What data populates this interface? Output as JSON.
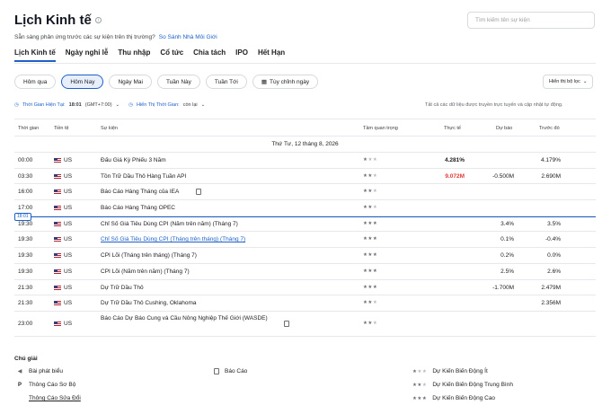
{
  "header": {
    "title": "Lịch Kinh tế",
    "info_icon": "info-icon",
    "search_placeholder": "Tìm kiếm tên sự kiện"
  },
  "subtitle": {
    "text": "Sẵn sàng phản ứng trước các sự kiện trên thị trường?",
    "link": "So Sánh Nhà Môi Giới"
  },
  "tabs": [
    "Lịch Kinh tế",
    "Ngày nghỉ lễ",
    "Thu nhập",
    "Cổ tức",
    "Chia tách",
    "IPO",
    "Hết Hạn"
  ],
  "chips": [
    "Hôm qua",
    "Hôm Nay",
    "Ngày Mai",
    "Tuần Này",
    "Tuần Tới",
    "Tùy chỉnh ngày"
  ],
  "filter_button": "Hiển thị bộ lọc",
  "time_info": {
    "label": "Thời Gian Hiện Tại:",
    "time": "18:01",
    "tz": "(GMT+7:00)",
    "display_label": "Hiển Thị Thời Gian:",
    "display_value": "còn lại"
  },
  "note": "Tất cả các dữ liệu được truyền trực tuyến và cập nhật tự động.",
  "table": {
    "headers": {
      "time": "Thời gian",
      "currency": "Tiền tệ",
      "event": "Sự kiện",
      "importance": "Tầm quan trọng",
      "actual": "Thực tế",
      "forecast": "Dự báo",
      "previous": "Trước đó"
    },
    "date": "Thứ Tư, 12 tháng 8, 2026",
    "now_marker": "18:01",
    "rows": [
      {
        "time": "00:00",
        "cur": "US",
        "event": "Đấu Giá Kỳ Phiếu 3 Năm",
        "imp": 1,
        "actual": "4.281%",
        "forecast": "",
        "previous": "4.179%"
      },
      {
        "time": "03:30",
        "cur": "US",
        "event": "Tồn Trữ Dầu Thô Hàng Tuần API",
        "imp": 2,
        "actual": "9.072M",
        "forecast": "-0.500M",
        "previous": "2.690M"
      },
      {
        "time": "16:00",
        "cur": "US",
        "event": "Báo Cáo Hàng Tháng của IEA",
        "imp": 2,
        "actual": "",
        "forecast": "",
        "previous": ""
      },
      {
        "time": "17:00",
        "cur": "US",
        "event": "Báo Cáo Hàng Tháng OPEC",
        "imp": 2,
        "actual": "",
        "forecast": "",
        "previous": ""
      },
      {
        "time": "19:30",
        "cur": "US",
        "event": "Chỉ Số Giá Tiêu Dùng CPI (Năm trên năm) (Tháng 7)",
        "imp": 3,
        "actual": "",
        "forecast": "3.4%",
        "previous": "3.5%"
      },
      {
        "time": "19:30",
        "cur": "US",
        "event": "Chỉ Số Giá Tiêu Dùng CPI (Tháng trên tháng) (Tháng 7)",
        "imp": 3,
        "actual": "",
        "forecast": "0.1%",
        "previous": "-0.4%"
      },
      {
        "time": "19:30",
        "cur": "US",
        "event": "CPI Lõi (Tháng trên tháng) (Tháng 7)",
        "imp": 3,
        "actual": "",
        "forecast": "0.2%",
        "previous": "0.0%"
      },
      {
        "time": "19:30",
        "cur": "US",
        "event": "CPI Lõi (Năm trên năm) (Tháng 7)",
        "imp": 3,
        "actual": "",
        "forecast": "2.5%",
        "previous": "2.6%"
      },
      {
        "time": "21:30",
        "cur": "US",
        "event": "Dự Trữ Dầu Thô",
        "imp": 3,
        "actual": "",
        "forecast": "-1.700M",
        "previous": "2.479M"
      },
      {
        "time": "21:30",
        "cur": "US",
        "event": "Dự Trữ Dầu Thô Cushing, Oklahoma",
        "imp": 2,
        "actual": "",
        "forecast": "",
        "previous": "2.356M"
      },
      {
        "time": "23:00",
        "cur": "US",
        "event": "Báo Cáo Dự Báo Cung và Cầu Nông Nghiệp Thế Giới (WASDE)",
        "imp": 2,
        "actual": "",
        "forecast": "",
        "previous": ""
      }
    ]
  },
  "legend": {
    "title": "Chú giải",
    "items": {
      "speech": "Bài phát biểu",
      "prelim": "Thông Cáo Sơ Bộ",
      "revised": "Thông Cáo Sửa Đổi",
      "report": "Báo Cáo",
      "low": "Dự Kiến Biến Động Ít",
      "mid": "Dự Kiến Biến Động Trung Bình",
      "high": "Dự Kiến Biến Động Cao"
    }
  },
  "colors": {
    "accent": "#1d61c8",
    "actual_negative": "#e53935"
  }
}
